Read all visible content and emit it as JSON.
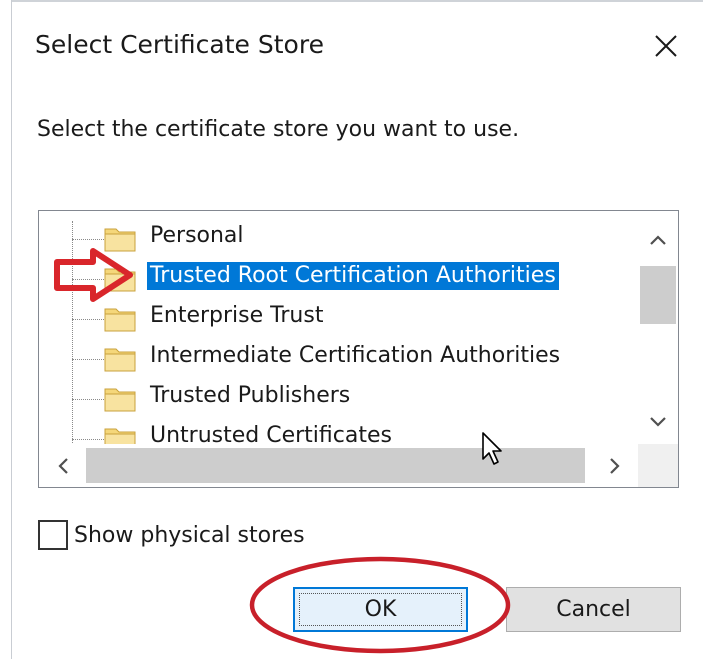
{
  "dialog": {
    "title": "Select Certificate Store",
    "instruction": "Select the certificate store you want to use."
  },
  "tree": {
    "items": [
      {
        "label": "Personal",
        "selected": false
      },
      {
        "label": "Trusted Root Certification Authorities",
        "selected": true
      },
      {
        "label": "Enterprise Trust",
        "selected": false
      },
      {
        "label": "Intermediate Certification Authorities",
        "selected": false
      },
      {
        "label": "Trusted Publishers",
        "selected": false
      },
      {
        "label": "Untrusted Certificates",
        "selected": false
      }
    ]
  },
  "options": {
    "show_physical_label": "Show physical stores",
    "show_physical_checked": false
  },
  "buttons": {
    "ok_label": "OK",
    "cancel_label": "Cancel"
  },
  "annotations": {
    "arrow_color": "#d9262b",
    "ellipse_color": "#c8202a"
  },
  "colors": {
    "selection": "#0078d7",
    "folder": "#f5d77a"
  },
  "icons": {
    "close": "close-icon",
    "folder": "folder-icon",
    "scroll_up": "chevron-up-icon",
    "scroll_down": "chevron-down-icon",
    "scroll_left": "chevron-left-icon",
    "scroll_right": "chevron-right-icon",
    "cursor": "mouse-cursor-icon"
  }
}
